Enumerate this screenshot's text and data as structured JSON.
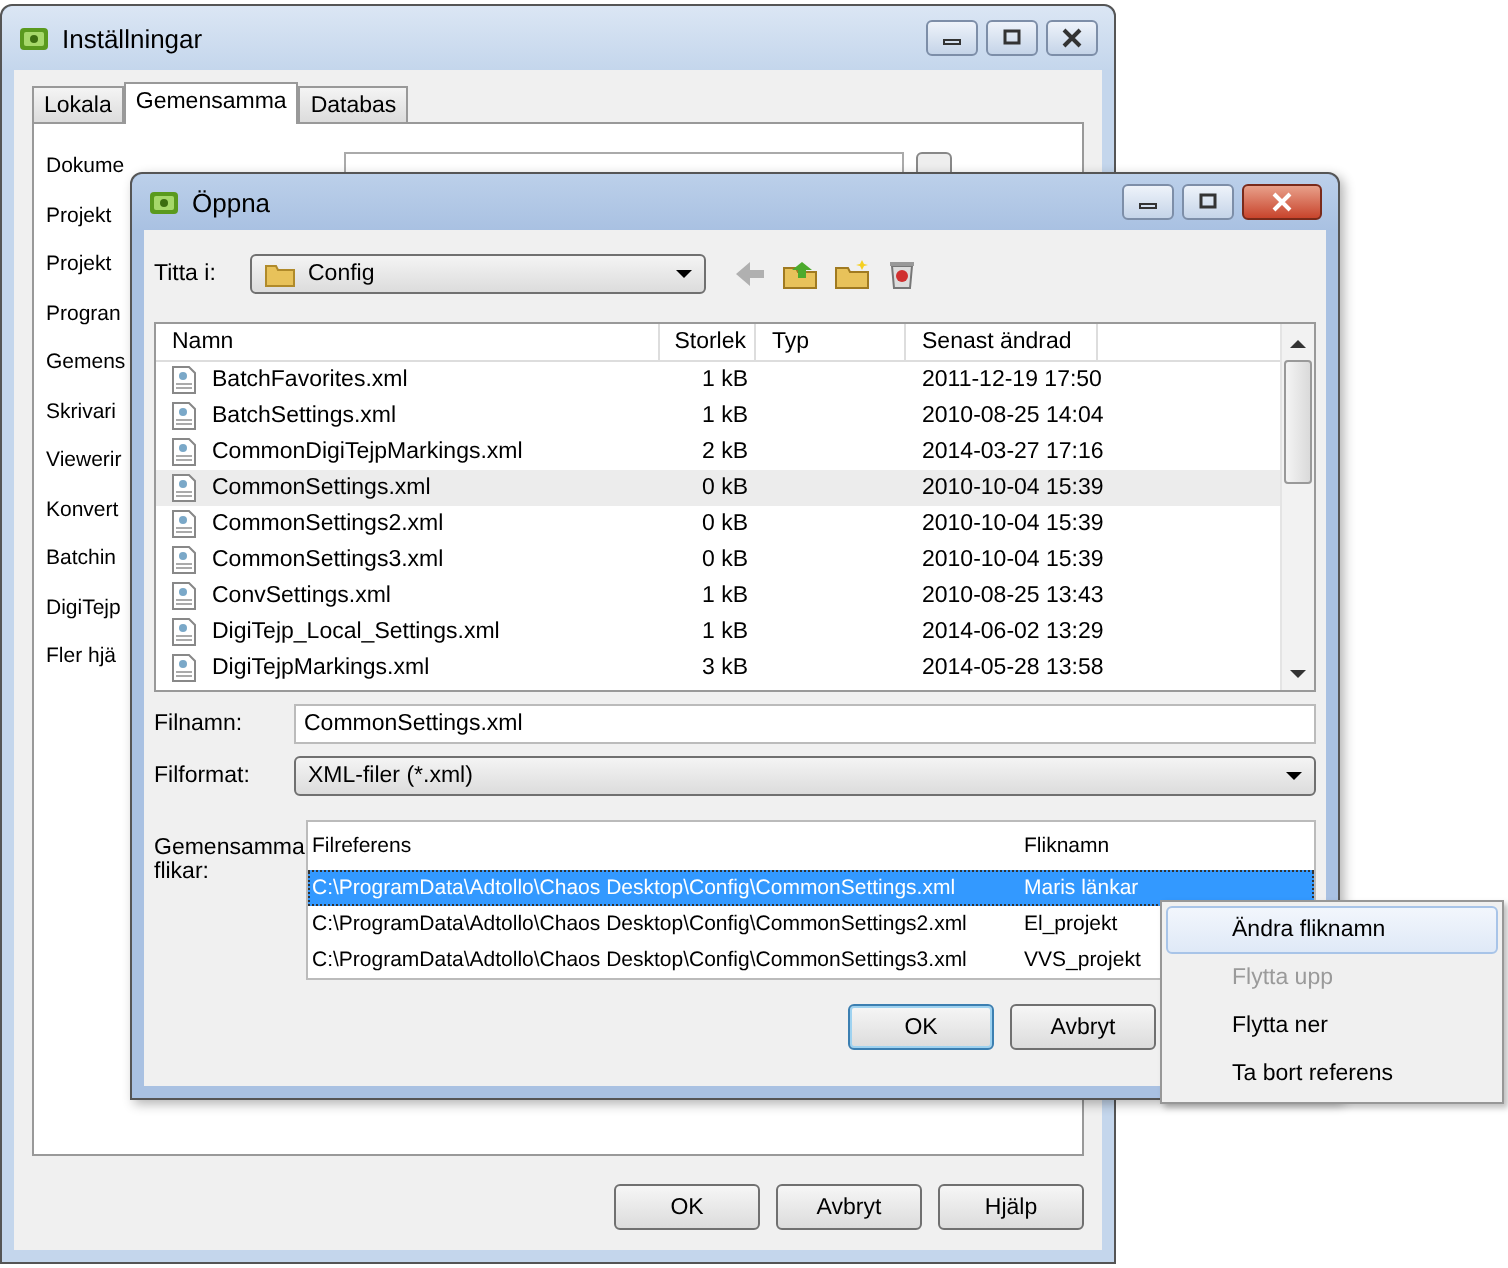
{
  "main_window": {
    "title": "Inställningar",
    "tabs": [
      {
        "label": "Lokala",
        "selected": false
      },
      {
        "label": "Gemensamma",
        "selected": true
      },
      {
        "label": "Databas",
        "selected": false
      }
    ],
    "labels": [
      "Dokume",
      "Projekt",
      "Projekt",
      "Progran",
      "Gemens",
      "Skrivari",
      "Viewerir",
      "Konvert",
      "Batchin",
      "DigiTejp",
      "Fler hjä"
    ],
    "buttons": [
      "OK",
      "Avbryt",
      "Hjälp"
    ]
  },
  "open_dialog": {
    "title": "Öppna",
    "look_in_label": "Titta i:",
    "look_in": "Config",
    "file_list": {
      "columns": [
        "Namn",
        "Storlek",
        "Typ",
        "Senast ändrad"
      ],
      "rows": [
        {
          "name": "BatchFavorites.xml",
          "size": "1 kB",
          "modified": "2011-12-19 17:50",
          "selected": false
        },
        {
          "name": "BatchSettings.xml",
          "size": "1 kB",
          "modified": "2010-08-25 14:04",
          "selected": false
        },
        {
          "name": "CommonDigiTejpMarkings.xml",
          "size": "2 kB",
          "modified": "2014-03-27 17:16",
          "selected": false
        },
        {
          "name": "CommonSettings.xml",
          "size": "0 kB",
          "modified": "2010-10-04 15:39",
          "selected": true
        },
        {
          "name": "CommonSettings2.xml",
          "size": "0 kB",
          "modified": "2010-10-04 15:39",
          "selected": false
        },
        {
          "name": "CommonSettings3.xml",
          "size": "0 kB",
          "modified": "2010-10-04 15:39",
          "selected": false
        },
        {
          "name": "ConvSettings.xml",
          "size": "1 kB",
          "modified": "2010-08-25 13:43",
          "selected": false
        },
        {
          "name": "DigiTejp_Local_Settings.xml",
          "size": "1 kB",
          "modified": "2014-06-02 13:29",
          "selected": false
        },
        {
          "name": "DigiTejpMarkings.xml",
          "size": "3 kB",
          "modified": "2014-05-28 13:58",
          "selected": false
        }
      ]
    },
    "filename_label": "Filnamn:",
    "filename": "CommonSettings.xml",
    "format_label": "Filformat:",
    "format": "XML-filer (*.xml)",
    "shared_tabs_label": "Gemensamma flikar:",
    "shared_tabs": {
      "columns": [
        "Filreferens",
        "Fliknamn"
      ],
      "rows": [
        {
          "file": "C:\\ProgramData\\Adtollo\\Chaos Desktop\\Config\\CommonSettings.xml",
          "name": "Maris länkar",
          "selected": true
        },
        {
          "file": "C:\\ProgramData\\Adtollo\\Chaos Desktop\\Config\\CommonSettings2.xml",
          "name": "El_projekt",
          "selected": false
        },
        {
          "file": "C:\\ProgramData\\Adtollo\\Chaos Desktop\\Config\\CommonSettings3.xml",
          "name": "VVS_projekt",
          "selected": false
        }
      ]
    },
    "buttons": [
      "OK",
      "Avbryt"
    ]
  },
  "context_menu": [
    {
      "label": "Ändra fliknamn",
      "disabled": false,
      "selected": true
    },
    {
      "label": "Flytta upp",
      "disabled": true,
      "selected": false
    },
    {
      "label": "Flytta ner",
      "disabled": false,
      "selected": false
    },
    {
      "label": "Ta bort referens",
      "disabled": false,
      "selected": false
    }
  ]
}
